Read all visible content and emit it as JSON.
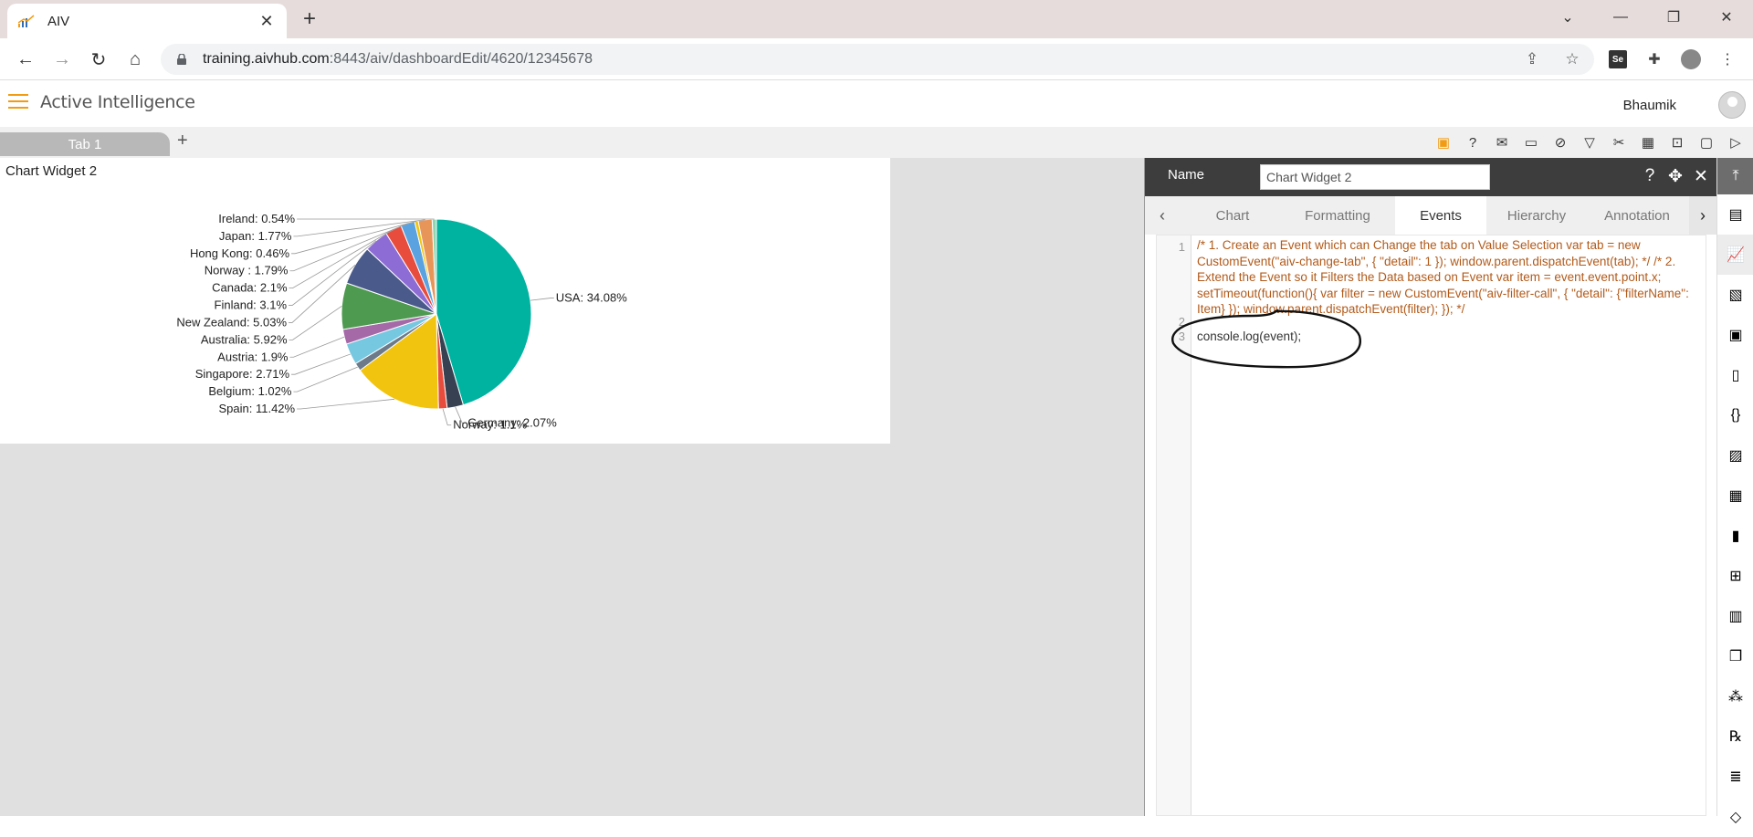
{
  "browser": {
    "tab_title": "AIV",
    "url_host": "training.aivhub.com",
    "url_path": ":8443/aiv/dashboardEdit/4620/12345678"
  },
  "app": {
    "title": "Active Intelligence",
    "user": "Bhaumik"
  },
  "dashboard": {
    "tab_label": "Tab 1",
    "add_tab": "+"
  },
  "widget": {
    "title": "Chart Widget 2"
  },
  "chart_data": {
    "type": "pie",
    "categories": [
      "USA",
      "Germany",
      "Norway",
      "Spain",
      "Belgium",
      "Singapore",
      "Austria",
      "Australia",
      "New Zealand",
      "Finland",
      "Canada",
      "Norway ",
      "Hong Kong",
      "Japan",
      "Ireland"
    ],
    "values": [
      34.08,
      2.07,
      1.1,
      11.42,
      1.02,
      2.71,
      1.9,
      5.92,
      5.03,
      3.1,
      2.1,
      1.79,
      0.46,
      1.77,
      0.54
    ],
    "labels": [
      "USA: 34.08%",
      "Germany: 2.07%",
      "Norway: 1.1%",
      "Spain: 11.42%",
      "Belgium: 1.02%",
      "Singapore: 2.71%",
      "Austria: 1.9%",
      "Australia: 5.92%",
      "New Zealand: 5.03%",
      "Finland: 3.1%",
      "Canada: 2.1%",
      "Norway : 1.79%",
      "Hong Kong: 0.46%",
      "Japan: 1.77%",
      "Ireland: 0.54%"
    ],
    "colors": [
      "#00b3a1",
      "#374151",
      "#e74c3c",
      "#f1c40f",
      "#6c7a89",
      "#76c7e0",
      "#a569a8",
      "#4e9a50",
      "#4a5a8a",
      "#8e6cd6",
      "#e74c3c",
      "#5ba3e0",
      "#f1c40f",
      "#e8955a",
      "#8fd6b0"
    ]
  },
  "panel": {
    "name_label": "Name",
    "name_value": "Chart Widget 2",
    "tabs": [
      "Chart",
      "Formatting",
      "Events",
      "Hierarchy",
      "Annotation"
    ],
    "active_tab": "Events",
    "line_numbers": [
      "1",
      "2",
      "3"
    ],
    "code_comment": "/* 1. Create an Event which can Change the tab on Value Selection var tab = new CustomEvent(\"aiv-change-tab\", {    \"detail\": 1 });  window.parent.dispatchEvent(tab);  */ /* 2. Extend the Event so it Filters the Data based on Event var item = event.event.point.x; setTimeout(function(){ var filter = new CustomEvent(\"aiv-filter-call\", {    \"detail\": {\"filterName\": Item}  }); window.parent.dispatchEvent(filter); }); */",
    "code_line3": "console.log(event);"
  },
  "icons": {
    "rail": [
      "collapse-top-icon",
      "table-icon",
      "chart-icon",
      "map-icon",
      "report-icon",
      "document-icon",
      "code-braces-icon",
      "image-icon",
      "grid-icon",
      "file-icon",
      "tree-icon",
      "bar-icon",
      "copy-icon",
      "cubes-icon",
      "rx-icon",
      "doc-lines-icon",
      "layers-icon"
    ]
  }
}
